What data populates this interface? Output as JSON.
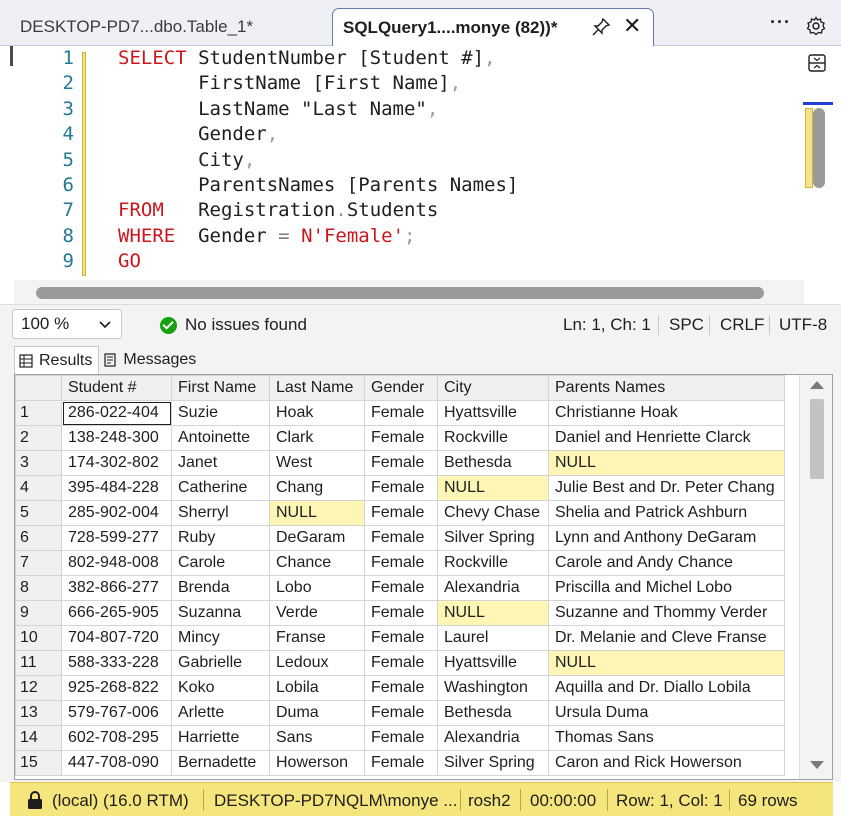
{
  "tabs": {
    "inactive_label": "DESKTOP-PD7...dbo.Table_1*",
    "active_label": "SQLQuery1....monye (82))*"
  },
  "editor": {
    "line_numbers": [
      "1",
      "2",
      "3",
      "4",
      "5",
      "6",
      "7",
      "8",
      "9"
    ],
    "lines": [
      [
        {
          "t": "SELECT",
          "c": "kw"
        },
        {
          "t": " StudentNumber [Student #]",
          "c": ""
        },
        {
          "t": ",",
          "c": "punc"
        }
      ],
      [
        {
          "t": "       FirstName [First Name]",
          "c": ""
        },
        {
          "t": ",",
          "c": "punc"
        }
      ],
      [
        {
          "t": "       LastName \"Last Name\"",
          "c": ""
        },
        {
          "t": ",",
          "c": "punc"
        }
      ],
      [
        {
          "t": "       Gender",
          "c": ""
        },
        {
          "t": ",",
          "c": "punc"
        }
      ],
      [
        {
          "t": "       City",
          "c": ""
        },
        {
          "t": ",",
          "c": "punc"
        }
      ],
      [
        {
          "t": "       ParentsNames [Parents Names]",
          "c": ""
        }
      ],
      [
        {
          "t": "FROM",
          "c": "kw"
        },
        {
          "t": "   Registration",
          "c": ""
        },
        {
          "t": ".",
          "c": "punc"
        },
        {
          "t": "Students",
          "c": ""
        }
      ],
      [
        {
          "t": "WHERE",
          "c": "kw"
        },
        {
          "t": "  Gender ",
          "c": ""
        },
        {
          "t": "=",
          "c": "op"
        },
        {
          "t": " ",
          "c": ""
        },
        {
          "t": "N'Female'",
          "c": "str"
        },
        {
          "t": ";",
          "c": "punc"
        }
      ],
      [
        {
          "t": "GO",
          "c": "kw"
        }
      ]
    ]
  },
  "infobar": {
    "zoom": "100 %",
    "issues": "No issues found",
    "position": "Ln: 1, Ch: 1",
    "whitespace": "SPC",
    "line_ending": "CRLF",
    "encoding": "UTF-8"
  },
  "results": {
    "tab_results": "Results",
    "tab_messages": "Messages",
    "columns": [
      "Student #",
      "First Name",
      "Last Name",
      "Gender",
      "City",
      "Parents Names"
    ],
    "rows": [
      [
        "1",
        "286-022-404",
        "Suzie",
        "Hoak",
        "Female",
        "Hyattsville",
        "Christianne Hoak"
      ],
      [
        "2",
        "138-248-300",
        "Antoinette",
        "Clark",
        "Female",
        "Rockville",
        "Daniel and Henriette Clarck"
      ],
      [
        "3",
        "174-302-802",
        "Janet",
        "West",
        "Female",
        "Bethesda",
        "NULL"
      ],
      [
        "4",
        "395-484-228",
        "Catherine",
        "Chang",
        "Female",
        "NULL",
        "Julie Best and Dr. Peter Chang"
      ],
      [
        "5",
        "285-902-004",
        "Sherryl",
        "NULL",
        "Female",
        "Chevy Chase",
        "Shelia and Patrick Ashburn"
      ],
      [
        "6",
        "728-599-277",
        "Ruby",
        "DeGaram",
        "Female",
        "Silver Spring",
        "Lynn and Anthony DeGaram"
      ],
      [
        "7",
        "802-948-008",
        "Carole",
        "Chance",
        "Female",
        "Rockville",
        "Carole and Andy Chance"
      ],
      [
        "8",
        "382-866-277",
        "Brenda",
        "Lobo",
        "Female",
        "Alexandria",
        "Priscilla and Michel Lobo"
      ],
      [
        "9",
        "666-265-905",
        "Suzanna",
        "Verde",
        "Female",
        "NULL",
        "Suzanne and Thommy Verder"
      ],
      [
        "10",
        "704-807-720",
        "Mincy",
        "Franse",
        "Female",
        "Laurel",
        "Dr. Melanie and Cleve Franse"
      ],
      [
        "11",
        "588-333-228",
        "Gabrielle",
        "Ledoux",
        "Female",
        "Hyattsville",
        "NULL"
      ],
      [
        "12",
        "925-268-822",
        "Koko",
        "Lobila",
        "Female",
        "Washington",
        "Aquilla and Dr. Diallo Lobila"
      ],
      [
        "13",
        "579-767-006",
        "Arlette",
        "Duma",
        "Female",
        "Bethesda",
        "Ursula Duma"
      ],
      [
        "14",
        "602-708-295",
        "Harriette",
        "Sans",
        "Female",
        "Alexandria",
        "Thomas Sans"
      ],
      [
        "15",
        "447-708-090",
        "Bernadette",
        "Howerson",
        "Female",
        "Silver Spring",
        "Caron and Rick Howerson"
      ]
    ]
  },
  "statusbar": {
    "server": "(local) (16.0 RTM)",
    "user": "DESKTOP-PD7NQLM\\monye ...",
    "database": "rosh2",
    "elapsed": "00:00:00",
    "position": "Row: 1, Col: 1",
    "row_count": "69 rows"
  },
  "colors": {
    "keyword": "#c9171e",
    "line_number": "#237893",
    "null_cell": "#fff6b5",
    "status_bar": "#f5e57d",
    "selection_marker": "#1f3fd6"
  }
}
